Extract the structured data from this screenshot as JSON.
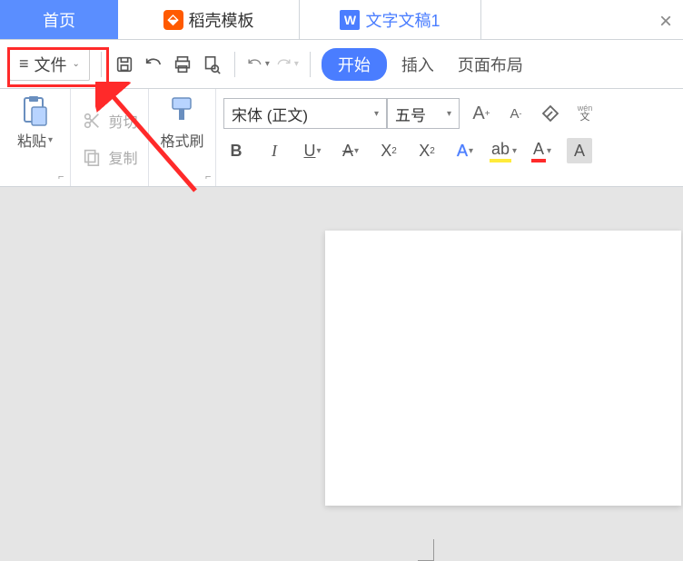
{
  "tabs": {
    "home": "首页",
    "docer": "稻壳模板",
    "doc": "文字文稿1"
  },
  "menu": {
    "file": "文件",
    "start": "开始",
    "insert": "插入",
    "page_layout": "页面布局"
  },
  "clipboard": {
    "paste": "粘贴",
    "cut": "剪切",
    "copy": "复制",
    "format_painter": "格式刷"
  },
  "font": {
    "name": "宋体 (正文)",
    "size": "五号"
  },
  "icons": {
    "hamburger": "≡",
    "chevron_down": "⌄",
    "save": "🖫",
    "undo": "↶",
    "redo": "↷",
    "print": "⎙",
    "preview": "⌕",
    "wen": "文",
    "bold": "B",
    "italic": "I",
    "underline": "U",
    "strike": "A",
    "superscript": "X",
    "subscript": "X",
    "text_effect": "A",
    "highlight": "ab",
    "font_color": "A",
    "char_shading": "A",
    "bigA": "A",
    "smallA": "A",
    "clear": "◇"
  }
}
